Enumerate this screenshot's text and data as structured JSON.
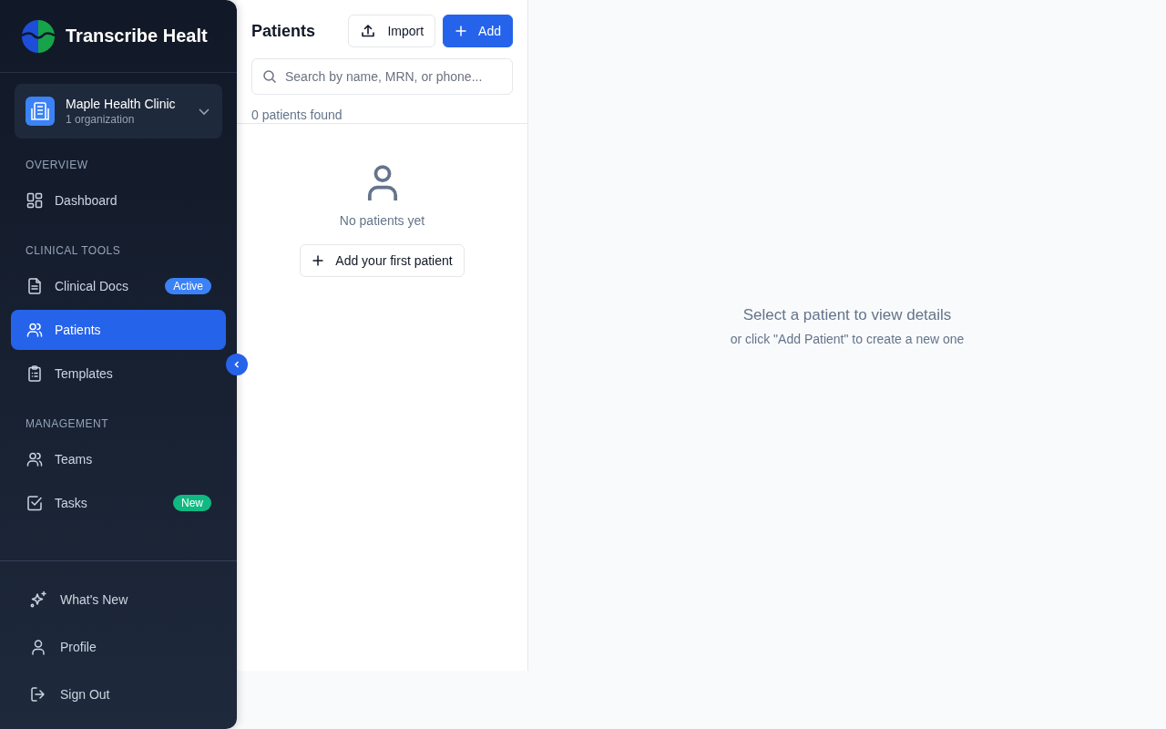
{
  "sidebar": {
    "brand": "Transcribe Healt",
    "organization": {
      "name": "Maple Health Clinic",
      "subtitle": "1 organization"
    },
    "sections": [
      {
        "heading": "OVERVIEW",
        "items": [
          {
            "label": "Dashboard",
            "selected": false
          }
        ]
      },
      {
        "heading": "CLINICAL TOOLS",
        "items": [
          {
            "label": "Clinical Docs",
            "selected": false,
            "badge": {
              "text": "Active",
              "color": "#3b82f6"
            }
          },
          {
            "label": "Patients",
            "selected": true
          },
          {
            "label": "Templates",
            "selected": false
          }
        ]
      },
      {
        "heading": "MANAGEMENT",
        "items": [
          {
            "label": "Teams",
            "selected": false
          },
          {
            "label": "Tasks",
            "selected": false,
            "badge": {
              "text": "New",
              "color": "#10b981"
            }
          }
        ]
      }
    ],
    "footer": [
      "What's New",
      "Profile",
      "Sign Out"
    ]
  },
  "patients_panel": {
    "title": "Patients",
    "import_button": "Import",
    "add_button": "Add",
    "search": {
      "placeholder": "Search by name, MRN, or phone..."
    },
    "count": "0 patients found",
    "empty": {
      "message": "No patients yet",
      "button": "Add your first patient"
    }
  },
  "detail": {
    "title": "Select a patient to view details",
    "hint": "or click \"Add Patient\" to create a new one"
  }
}
